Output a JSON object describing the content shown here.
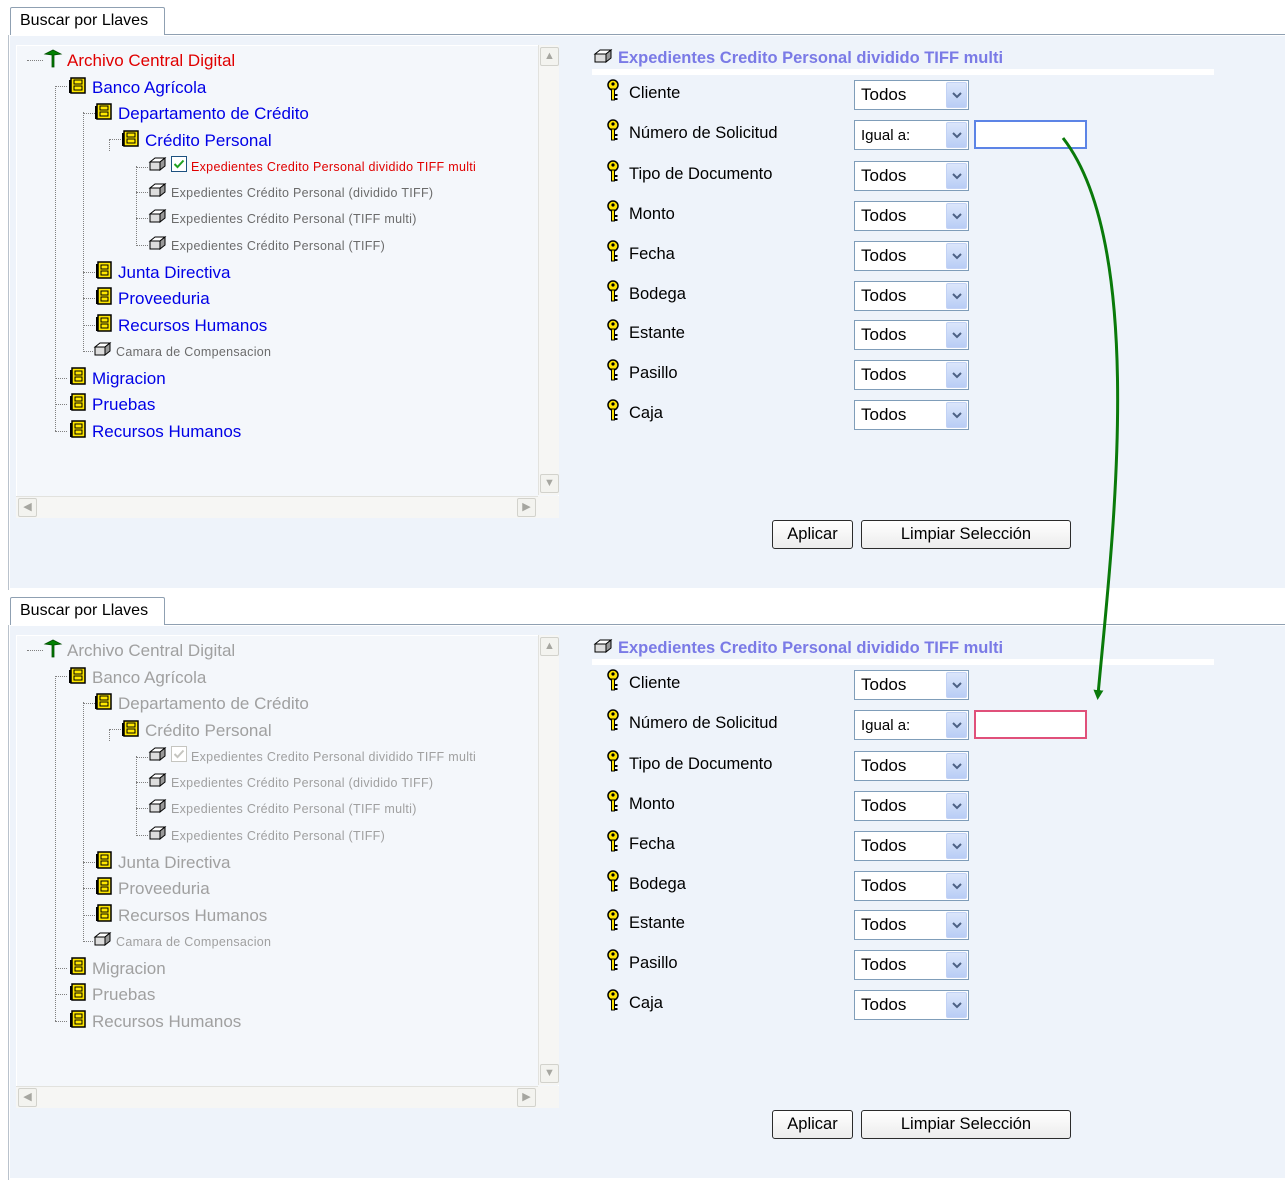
{
  "tab_label": "Buscar por Llaves",
  "colors": {
    "link_blue": "#0000e6",
    "selected_red": "#e00000",
    "title_purple": "#7a7ae6",
    "active_input_border": "#5c84e6",
    "error_input_border": "#e0507a",
    "arrow_green": "#0a7a0a"
  },
  "tree": {
    "root": "Archivo Central Digital",
    "level1_a": "Banco Agrícola",
    "dept": "Departamento de Crédito",
    "credito": "Crédito Personal",
    "doc1": "Expedientes Credito Personal dividido TIFF multi",
    "doc2": "Expedientes Crédito Personal (dividido TIFF)",
    "doc3": "Expedientes Crédito Personal (TIFF multi)",
    "doc4": "Expedientes Crédito Personal (TIFF)",
    "junta": "Junta Directiva",
    "prov": "Proveeduria",
    "rrhh1": "Recursos Humanos",
    "camara": "Camara de Compensacion",
    "migracion": "Migracion",
    "pruebas": "Pruebas",
    "rrhh2": "Recursos Humanos"
  },
  "form": {
    "title": "Expedientes Credito Personal dividido TIFF multi",
    "fields": [
      {
        "label": "Cliente",
        "value": "Todos"
      },
      {
        "label": "Número de Solicitud",
        "value": "Igual a:"
      },
      {
        "label": "Tipo de Documento",
        "value": "Todos"
      },
      {
        "label": "Monto",
        "value": "Todos"
      },
      {
        "label": "Fecha",
        "value": "Todos"
      },
      {
        "label": "Bodega",
        "value": "Todos"
      },
      {
        "label": "Estante",
        "value": "Todos"
      },
      {
        "label": "Pasillo",
        "value": "Todos"
      },
      {
        "label": "Caja",
        "value": "Todos"
      }
    ],
    "apply_label": "Aplicar",
    "clear_label": "Limpiar Selección"
  },
  "solicitud_input_value": ""
}
